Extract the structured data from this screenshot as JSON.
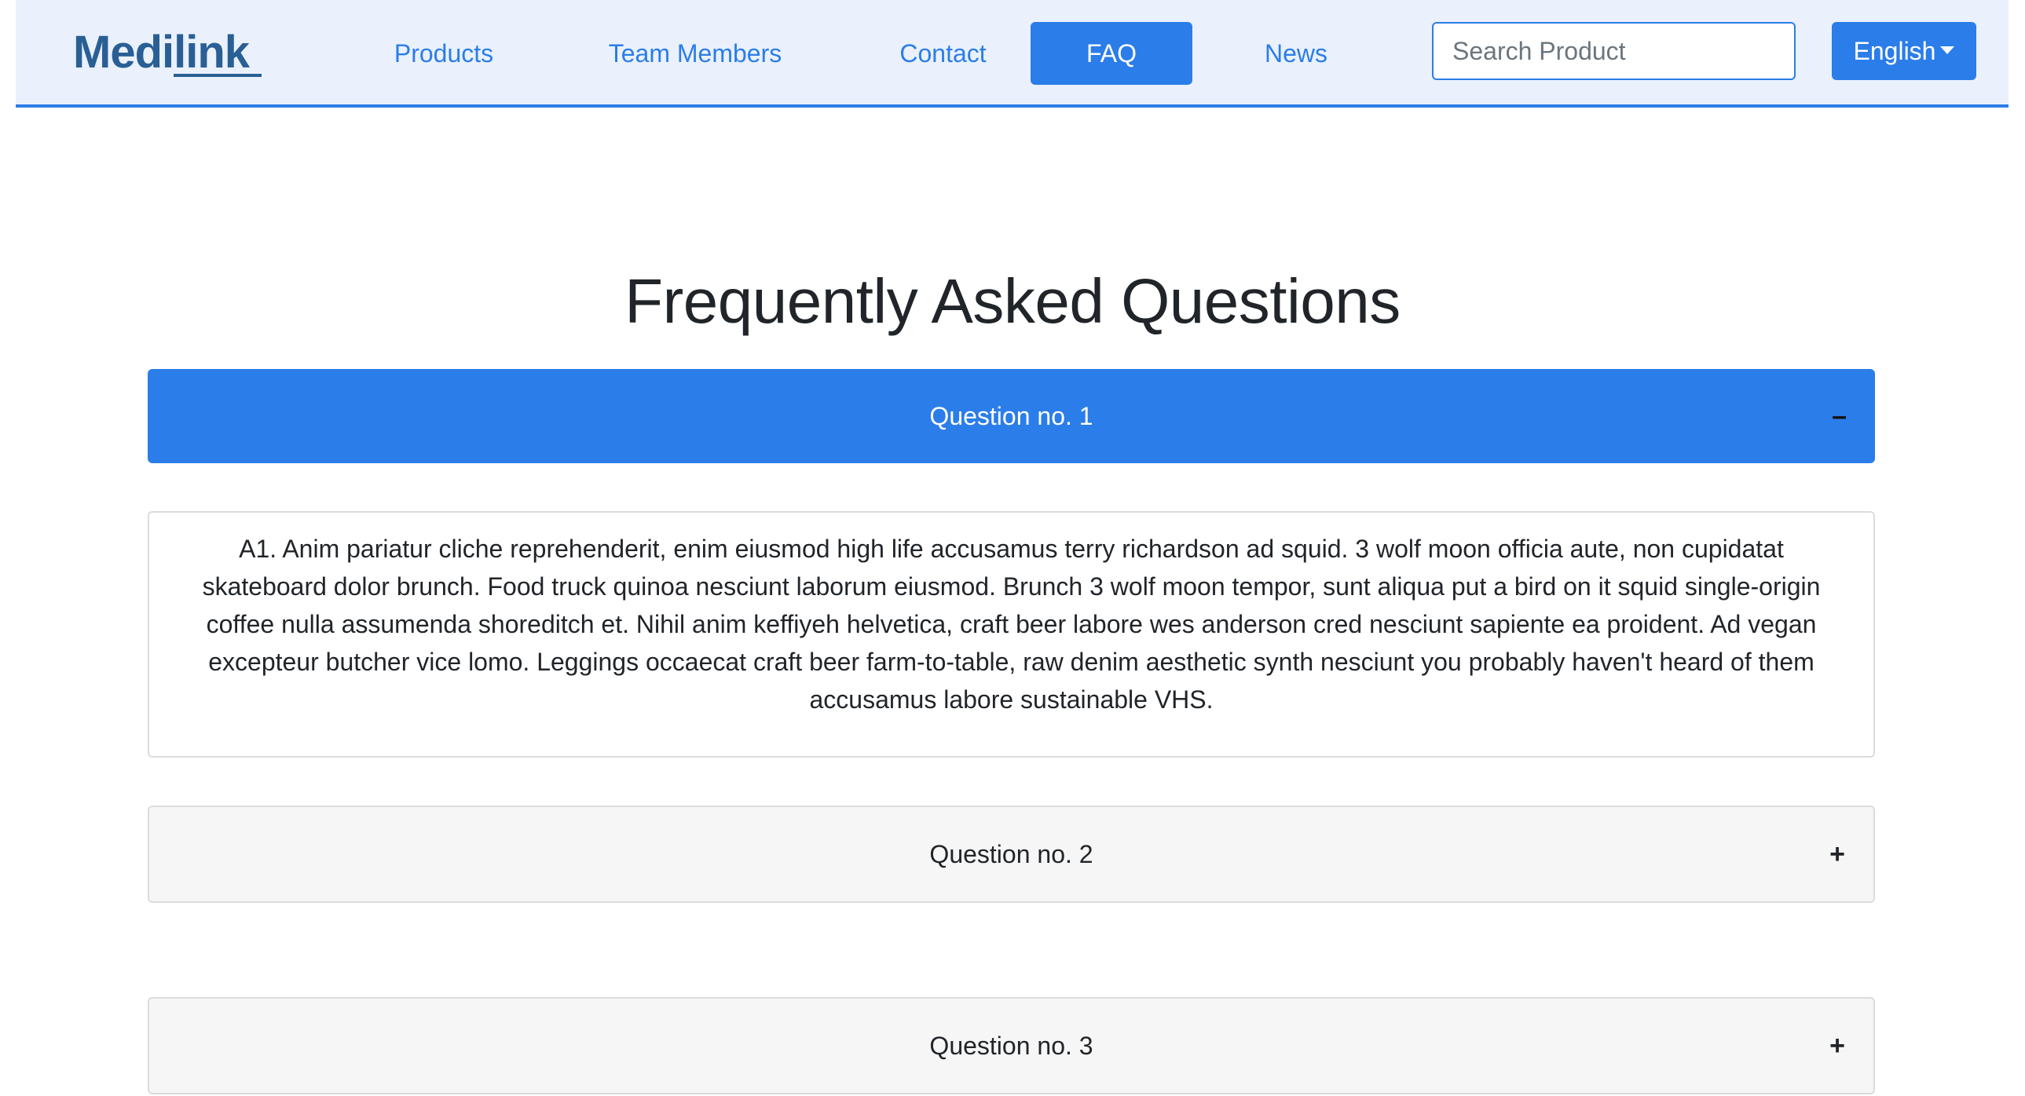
{
  "brand": {
    "logo_text": "Medilink"
  },
  "nav": {
    "items": [
      {
        "label": "Products"
      },
      {
        "label": "Team Members"
      },
      {
        "label": "Contact"
      },
      {
        "label": "FAQ",
        "active": true
      },
      {
        "label": "News"
      }
    ],
    "search_placeholder": "Search Product",
    "language_label": "English"
  },
  "page": {
    "title": "Frequently Asked Questions"
  },
  "faq": [
    {
      "question": "Question no. 1",
      "expanded": true,
      "toggle": "–",
      "answer": "A1. Anim pariatur cliche reprehenderit, enim eiusmod high life accusamus terry richardson ad squid. 3 wolf moon officia aute, non cupidatat skateboard dolor brunch. Food truck quinoa nesciunt laborum eiusmod. Brunch 3 wolf moon tempor, sunt aliqua put a bird on it squid single-origin coffee nulla assumenda shoreditch et. Nihil anim keffiyeh helvetica, craft beer labore wes anderson cred nesciunt sapiente ea proident. Ad vegan excepteur butcher vice lomo. Leggings occaecat craft beer farm-to-table, raw denim aesthetic synth nesciunt you probably haven't heard of them accusamus labore sustainable VHS."
    },
    {
      "question": "Question no. 2",
      "expanded": false,
      "toggle": "+"
    },
    {
      "question": "Question no. 3",
      "expanded": false,
      "toggle": "+"
    }
  ],
  "colors": {
    "primary": "#2b7de9",
    "navbar_bg": "#eaf1fc",
    "logo": "#2a5f95",
    "closed_header_bg": "#f6f6f6",
    "text": "#212529"
  }
}
